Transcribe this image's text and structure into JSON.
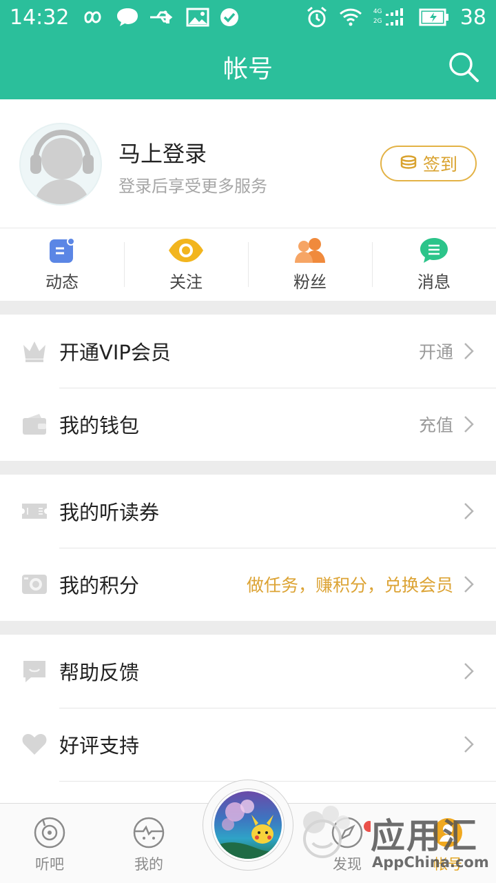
{
  "status_bar": {
    "time": "14:32",
    "battery": "38",
    "signal_top": "4G",
    "signal_bottom": "2G"
  },
  "header": {
    "title": "帐号"
  },
  "profile": {
    "name": "马上登录",
    "subtitle": "登录后享受更多服务",
    "signin_label": "签到"
  },
  "quick_actions": [
    {
      "label": "动态",
      "icon": "feed-icon",
      "color": "#5b86e5"
    },
    {
      "label": "关注",
      "icon": "eye-icon",
      "color": "#f2b51e"
    },
    {
      "label": "粉丝",
      "icon": "fans-icon",
      "color": "#f08a3c"
    },
    {
      "label": "消息",
      "icon": "message-icon",
      "color": "#2cc48a"
    }
  ],
  "menu_sections": [
    [
      {
        "label": "开通VIP会员",
        "right": "开通",
        "icon": "crown-icon"
      },
      {
        "label": "我的钱包",
        "right": "充值",
        "icon": "wallet-icon"
      }
    ],
    [
      {
        "label": "我的听读券",
        "right": "",
        "icon": "ticket-icon"
      },
      {
        "label": "我的积分",
        "right": "做任务，赚积分，兑换会员",
        "icon": "points-icon"
      }
    ],
    [
      {
        "label": "帮助反馈",
        "right": "",
        "icon": "feedback-icon"
      },
      {
        "label": "好评支持",
        "right": "",
        "icon": "heart-icon"
      }
    ]
  ],
  "bottom_nav": {
    "items": [
      {
        "label": "听吧",
        "icon": "record-icon"
      },
      {
        "label": "我的",
        "icon": "face-icon"
      },
      {
        "label": "发现",
        "icon": "compass-icon"
      },
      {
        "label": "帐号",
        "icon": "account-icon"
      }
    ]
  },
  "watermark": {
    "text": "应用汇",
    "subtext": "AppChina.com"
  },
  "colors": {
    "brand": "#2bbf9b",
    "gold": "#d9a22e",
    "accent_text": "#dca334"
  }
}
